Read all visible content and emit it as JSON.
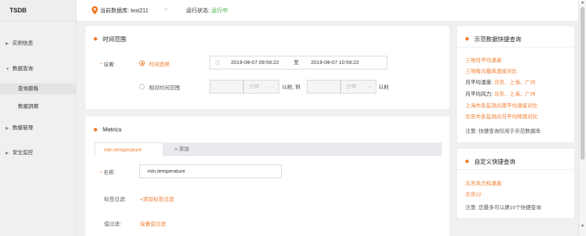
{
  "app": {
    "title": "TSDB"
  },
  "sidebar": {
    "items": [
      {
        "label": "实例信息"
      },
      {
        "label": "数据查询"
      },
      {
        "label": "查询面板"
      },
      {
        "label": "数据洞察"
      },
      {
        "label": "数据管理"
      },
      {
        "label": "安全监控"
      }
    ]
  },
  "header": {
    "db_label": "当前数据库: test211",
    "state_label": "运行状态:",
    "state_value": "运行中"
  },
  "time_range": {
    "title": "时间范围",
    "setting_label": "设置:",
    "option_select": "时间选择",
    "option_relative": "相对时间范围",
    "start_time": "2019-08-07 09:59:22",
    "to_label": "至",
    "end_time": "2019-08-07 10:59:22",
    "unit_placeholder": "分钟",
    "before_to": "以前, 到",
    "before": "以前"
  },
  "metrics": {
    "title": "Metrics",
    "tab_label": "min.temperature",
    "add_tab": "+ 添加",
    "name_label": "名称:",
    "name_value": "min.temperature",
    "tag_filter_label": "标签过滤:",
    "tag_filter_link": "+添加标签过滤",
    "value_filter_label": "值过滤:",
    "value_filter_link": "设置值过滤"
  },
  "demo_queries": {
    "title": "示范数据快捷查询",
    "links": [
      "三地月平均温度",
      "三地每月最高温度对比"
    ],
    "monthly_temp_label": "月平均温度:",
    "monthly_temp_cities": "北京、上海、广州",
    "monthly_wind_label": "月平均风力:",
    "monthly_wind_cities": "北京、上海、广州",
    "links2": [
      "上海市各监测点周平均温度对比",
      "北京市各监测点月平均降雨对比"
    ],
    "note": "注意: 快捷查询仅用于示范数据库"
  },
  "custom_queries": {
    "title": "自定义快捷查询",
    "links": [
      "北京风力和温度",
      "北京22"
    ],
    "note": "注意: 您最多可以建10个快捷查询"
  },
  "colors": {
    "accent": "#f07a2a",
    "running": "#3eae3e"
  }
}
